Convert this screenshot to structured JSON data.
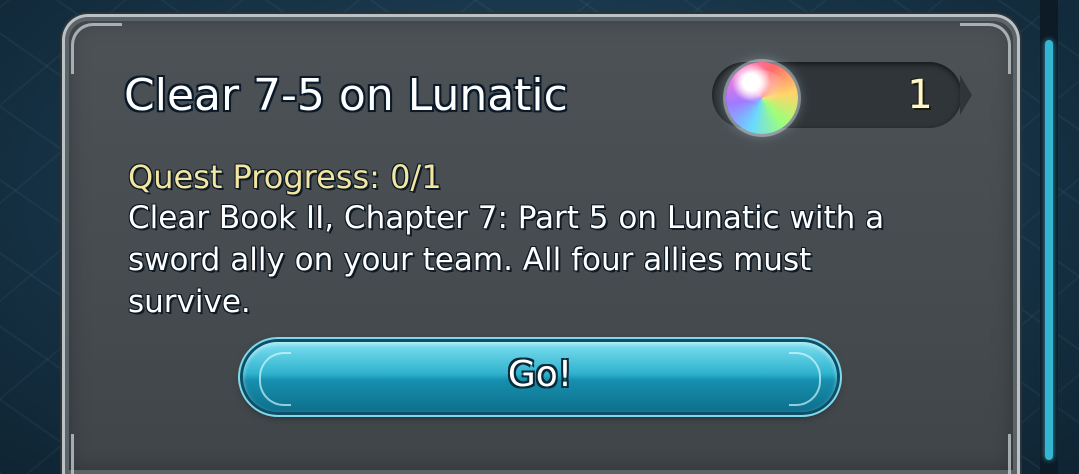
{
  "quest": {
    "title": "Clear 7-5 on Lunatic",
    "progress_text": "Quest Progress: 0/1",
    "description": "Clear Book II, Chapter 7: Part 5 on Lunatic with a sword ally on your team. All four allies must survive.",
    "reward": {
      "icon": "orb-icon",
      "count": "1"
    },
    "go_button_label": "Go!"
  },
  "colors": {
    "progress_text": "#f2e6a2",
    "button_accent": "#2fb3cf",
    "scrollbar": "#33b6d2"
  }
}
